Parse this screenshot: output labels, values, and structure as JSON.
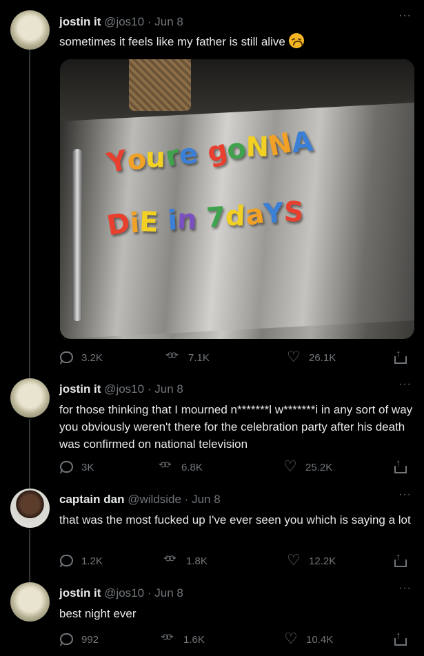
{
  "tweets": [
    {
      "author": "jostin it",
      "handle": "@jos10",
      "date": "Jun 8",
      "text": "sometimes it feels like my father is still alive",
      "emoji": "disappointed-face",
      "media": {
        "magnet_line_1": [
          "Y",
          "o",
          "u",
          "r",
          "e",
          " ",
          "g",
          "o",
          "N",
          "N",
          "A"
        ],
        "magnet_line_2": [
          "D",
          "i",
          "E",
          " ",
          "i",
          "n",
          " ",
          "7",
          "d",
          "a",
          "Y",
          "S"
        ]
      },
      "stats": {
        "replies": "3.2K",
        "retweets": "7.1K",
        "likes": "26.1K"
      }
    },
    {
      "author": "jostin it",
      "handle": "@jos10",
      "date": "Jun 8",
      "text": "for those thinking that I mourned n*******l w*******i in any sort of way you obviously weren't there for the celebration party after his death was confirmed on national television",
      "stats": {
        "replies": "3K",
        "retweets": "6.8K",
        "likes": "25.2K"
      }
    },
    {
      "author": "captain dan",
      "handle": "@wildside",
      "date": "Jun 8",
      "text": "that was the most fucked up I've ever seen you which is saying a lot",
      "stats": {
        "replies": "1.2K",
        "retweets": "1.8K",
        "likes": "12.2K"
      }
    },
    {
      "author": "jostin it",
      "handle": "@jos10",
      "date": "Jun 8",
      "text": "best night ever",
      "stats": {
        "replies": "992",
        "retweets": "1.6K",
        "likes": "10.4K"
      }
    }
  ],
  "separator": "·",
  "more_label": "···",
  "colors": {
    "background": "#000000",
    "text": "#e7e9ea",
    "muted": "#71767b",
    "thread": "#333639"
  }
}
